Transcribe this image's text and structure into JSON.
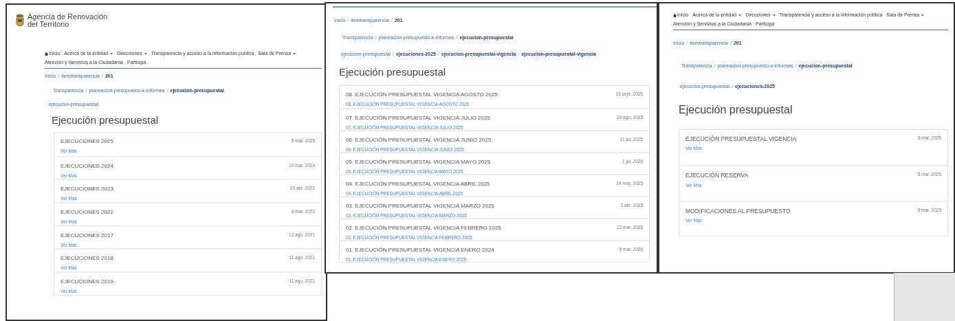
{
  "panels": [
    {
      "logo": {
        "line_1": "Agencia de Renovación",
        "line_2": "del Territorio"
      },
      "nav": [
        {
          "label": "Inicio",
          "home": true,
          "dropdown": false
        },
        {
          "label": "Acerca de la entidad",
          "home": false,
          "dropdown": true
        },
        {
          "label": "Direcciones",
          "home": false,
          "dropdown": true
        },
        {
          "label": "Transparencia y acceso a la información pública",
          "home": false,
          "dropdown": false
        },
        {
          "label": "Sala de Prensa",
          "home": false,
          "dropdown": true
        },
        {
          "label": "Atención y Servicios a la Ciudadanía",
          "home": false,
          "dropdown": false
        },
        {
          "label": "Participa",
          "home": false,
          "dropdown": false
        }
      ],
      "breadcrumbs": [
        [
          {
            "text": "Inicio",
            "bold": false
          },
          {
            "separator": "/",
            "text": "itemtransparencia",
            "bold": false
          },
          {
            "separator": "/",
            "text": "201",
            "bold": true
          }
        ],
        [
          {
            "text": "Transparencia",
            "bold": false
          },
          {
            "separator": "/",
            "text": "planeacion-presupuesto-e-informes",
            "bold": false
          },
          {
            "separator": "/",
            "text": "ejecucion-presupuestal",
            "bold": true
          }
        ],
        [
          {
            "text": "ejecucion-presupuestal",
            "bold": false
          }
        ]
      ],
      "heading": "Ejecución presupuestal",
      "items": [
        {
          "title": "EJECUCIONES 2025",
          "link": "Ver Más",
          "date": "5 mar. 2025"
        },
        {
          "title": "EJECUCIONES 2024",
          "link": "Ver Más",
          "date": "10 mar. 2024"
        },
        {
          "title": "EJECUCIONES 2023",
          "link": "Ver Más",
          "date": "10 abr. 2023"
        },
        {
          "title": "EJECUCIONES 2022",
          "link": "Ver Más",
          "date": "8 mar. 2022"
        },
        {
          "title": "EJECUCIONES 2017",
          "link": "Ver Más",
          "date": "12 ago. 2021"
        },
        {
          "title": "EJECUCIONES 2018",
          "link": "Ver Más",
          "date": "11 ago. 2021"
        },
        {
          "title": "EJECUCIONES 2019",
          "link": "Ver Más",
          "date": "11 ago. 2021"
        }
      ]
    },
    {
      "breadcrumbs": [
        [
          {
            "text": "Inicio",
            "bold": false
          },
          {
            "separator": "/",
            "text": "itemtransparencia",
            "bold": false
          },
          {
            "separator": "/",
            "text": "201",
            "bold": true
          }
        ],
        [
          {
            "text": "Transparencia",
            "bold": false
          },
          {
            "separator": "/",
            "text": "planeacion-presupuesto-e-informes",
            "bold": false
          },
          {
            "separator": "/",
            "text": "ejecucion-presupuestal",
            "bold": true
          }
        ],
        [
          {
            "text": "ejecucion-presupuestal",
            "bold": false
          },
          {
            "separator": "/",
            "text": "ejecuciones-2025",
            "bold": true
          },
          {
            "separator": "/",
            "text": "ejecucion-presupuestal-vigencia",
            "bold": true
          },
          {
            "separator": "/",
            "text": "ejecucion-presupuestal-vigencia",
            "bold": true
          }
        ]
      ],
      "heading": "Ejecución presupuestal",
      "items": [
        {
          "title": "08. EJECUCIÓN PRESUPUESTAL VIGENCIA AGOSTO 2025",
          "link": "08. EJECUCIÓN PRESUPUESTAL VIGENCIA AGOSTO 2025",
          "date": "16 sept. 2025"
        },
        {
          "title": "07. EJECUCIÓN PRESUPUESTAL VIGENCIA JULIO 2025",
          "link": "07. EJECUCIÓN PRESUPUESTAL VIGENCIA JULIO 2025",
          "date": "20 ago. 2025"
        },
        {
          "title": "06. EJECUCIÓN PRESUPUESTAL VIGENCIA JUNIO 2025",
          "link": "06. EJECUCIÓN PRESUPUESTAL VIGENCIA JUNIO 2025",
          "date": "11 jul. 2025"
        },
        {
          "title": "05. EJECUCIÓN PRESUPUESTAL VIGENCIA MAYO 2025",
          "link": "05. EJECUCIÓN PRESUPUESTAL VIGENCIA MAYO 2025",
          "date": "1 jul. 2025"
        },
        {
          "title": "04. EJECUCIÓN PRESUPUESTAL VIGENCIA ABRIL 2025",
          "link": "04. EJECUCIÓN PRESUPUESTAL VIGENCIA ABRIL 2025",
          "date": "14 may. 2025"
        },
        {
          "title": "03. EJECUCIÓN PRESUPUESTAL VIGENCIA MARZO 2025",
          "link": "03. EJECUCIÓN PRESUPUESTAL VIGENCIA MARZO 2025",
          "date": "3 abr. 2025"
        },
        {
          "title": "02. EJECUCIÓN PRESUPUESTAL VIGENCIA FEBRERO 2025",
          "link": "02. EJECUCIÓN PRESUPUESTAL VIGENCIA FEBRERO 2025",
          "date": "12 mar. 2025"
        },
        {
          "title": "01. EJECUCIÓN PRESUPUESTAL VIGENCIA ENERO 2024",
          "link": "01. EJECUCIÓN PRESUPUESTAL VIGENCIA ENERO 2025",
          "date": "5 mar. 2025"
        }
      ]
    },
    {
      "nav": [
        {
          "label": "Inicio",
          "home": true,
          "dropdown": false
        },
        {
          "label": "Acerca de la entidad",
          "home": false,
          "dropdown": true
        },
        {
          "label": "Direcciones",
          "home": false,
          "dropdown": true
        },
        {
          "label": "Transparencia y acceso a la información pública",
          "home": false,
          "dropdown": false
        },
        {
          "label": "Sala de Prensa",
          "home": false,
          "dropdown": true
        },
        {
          "label": "Atención y Servicios a la Ciudadanía",
          "home": false,
          "dropdown": false
        },
        {
          "label": "Participa",
          "home": false,
          "dropdown": false
        }
      ],
      "breadcrumbs": [
        [
          {
            "text": "Inicio",
            "bold": false
          },
          {
            "separator": "/",
            "text": "itemtransparencia",
            "bold": false
          },
          {
            "separator": "/",
            "text": "201",
            "bold": true
          }
        ],
        [
          {
            "text": "Transparencia",
            "bold": false
          },
          {
            "separator": "/",
            "text": "planeacion-presupuesto-e-informes",
            "bold": false
          },
          {
            "separator": "/",
            "text": "ejecucion-presupuestal",
            "bold": true
          }
        ],
        [
          {
            "text": "ejecucion-presupuestal",
            "bold": false
          },
          {
            "separator": "/",
            "text": "ejecuciones-2025",
            "bold": true
          }
        ]
      ],
      "heading": "Ejecución presupuestal",
      "items": [
        {
          "title": "EJECUCIÓN PRESUPUESTAL VIGENCIA",
          "link": "Ver Más",
          "date": "5 mar. 2025"
        },
        {
          "title": "EJECUCIÓN RESERVA",
          "link": "Ver Más",
          "date": "5 mar. 2025"
        },
        {
          "title": "MODIFICACIONES AL PRESUPUESTO",
          "link": "Ver Más",
          "date": "5 mar. 2025"
        }
      ]
    }
  ]
}
